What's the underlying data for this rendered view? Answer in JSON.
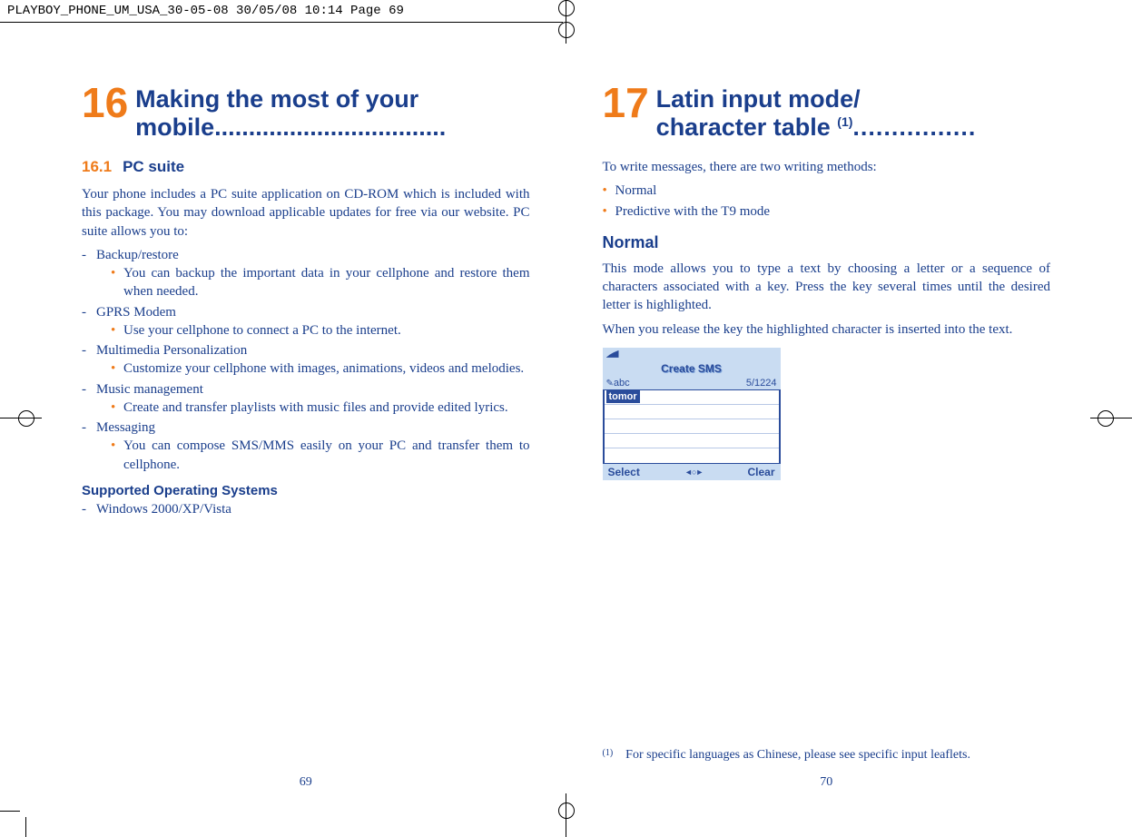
{
  "header": "PLAYBOY_PHONE_UM_USA_30-05-08  30/05/08  10:14  Page 69",
  "left": {
    "chapter_num": "16",
    "chapter_title": "Making the most of your mobile..................................",
    "sub_num": "16.1",
    "sub_title": "PC suite",
    "intro": "Your phone includes a PC suite application on CD-ROM which is included with this package.  You may download applicable updates for free via our website.  PC suite allows you to:",
    "items": [
      {
        "head": "Backup/restore",
        "bullets": [
          "You can backup the important data in your cellphone and restore them when needed."
        ]
      },
      {
        "head": "GPRS Modem",
        "bullets": [
          "Use your cellphone to connect a PC to the internet."
        ]
      },
      {
        "head": "Multimedia Personalization",
        "bullets": [
          "Customize your cellphone with images, animations, videos and melodies."
        ]
      },
      {
        "head": "Music management",
        "bullets": [
          "Create and transfer playlists with music files and provide edited lyrics."
        ]
      },
      {
        "head": "Messaging",
        "bullets": [
          "You can compose SMS/MMS easily on your PC and transfer them to cellphone."
        ]
      }
    ],
    "os_head": "Supported Operating Systems",
    "os_item": "Windows 2000/XP/Vista",
    "page_num": "69"
  },
  "right": {
    "chapter_num": "17",
    "chapter_title_a": "Latin input mode/",
    "chapter_title_b": "character table ",
    "chapter_title_sup": "(1)",
    "chapter_title_dots": "................",
    "intro": "To write messages, there are two writing methods:",
    "methods": [
      "Normal",
      "Predictive with the T9 mode"
    ],
    "h_normal": "Normal",
    "normal_p1": "This mode allows you to type a text by choosing a letter or a sequence of characters associated with a key. Press the key several times until the desired letter is highlighted.",
    "normal_p2": "When you release the key the highlighted character is inserted into the text.",
    "phone": {
      "title": "Create SMS",
      "mode": "abc",
      "counter": "5/1224",
      "word": "tomor",
      "soft_left": "Select",
      "soft_right": "Clear"
    },
    "footnote_mark": "(1)",
    "footnote_text": "For specific languages as Chinese, please see specific input leaflets.",
    "page_num": "70"
  }
}
